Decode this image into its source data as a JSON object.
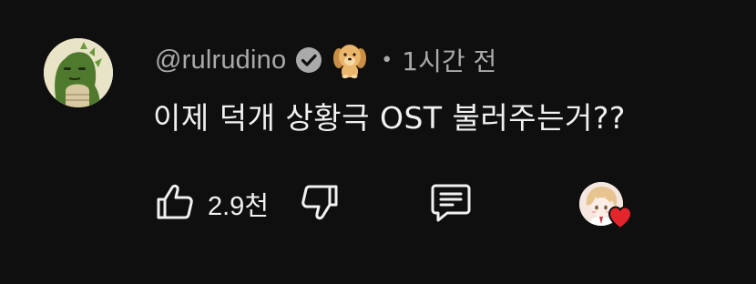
{
  "comment": {
    "author_handle": "@rulrudino",
    "verified_icon": "verified-check-icon",
    "badge_icon": "golden-retriever-badge-icon",
    "separator": "•",
    "time_ago": "1시간 전",
    "text": "이제 덕개 상황극 OST 불러주는거??",
    "like_count": "2.9천",
    "creator_heart": true,
    "colors": {
      "background": "#0f0f0f",
      "primary_text": "#f1f1f1",
      "secondary_text": "#aaaaaa",
      "heart": "#e5252c"
    },
    "icons": {
      "like": "thumbs-up-icon",
      "dislike": "thumbs-down-icon",
      "reply": "comment-reply-icon",
      "heart": "heart-icon"
    }
  }
}
